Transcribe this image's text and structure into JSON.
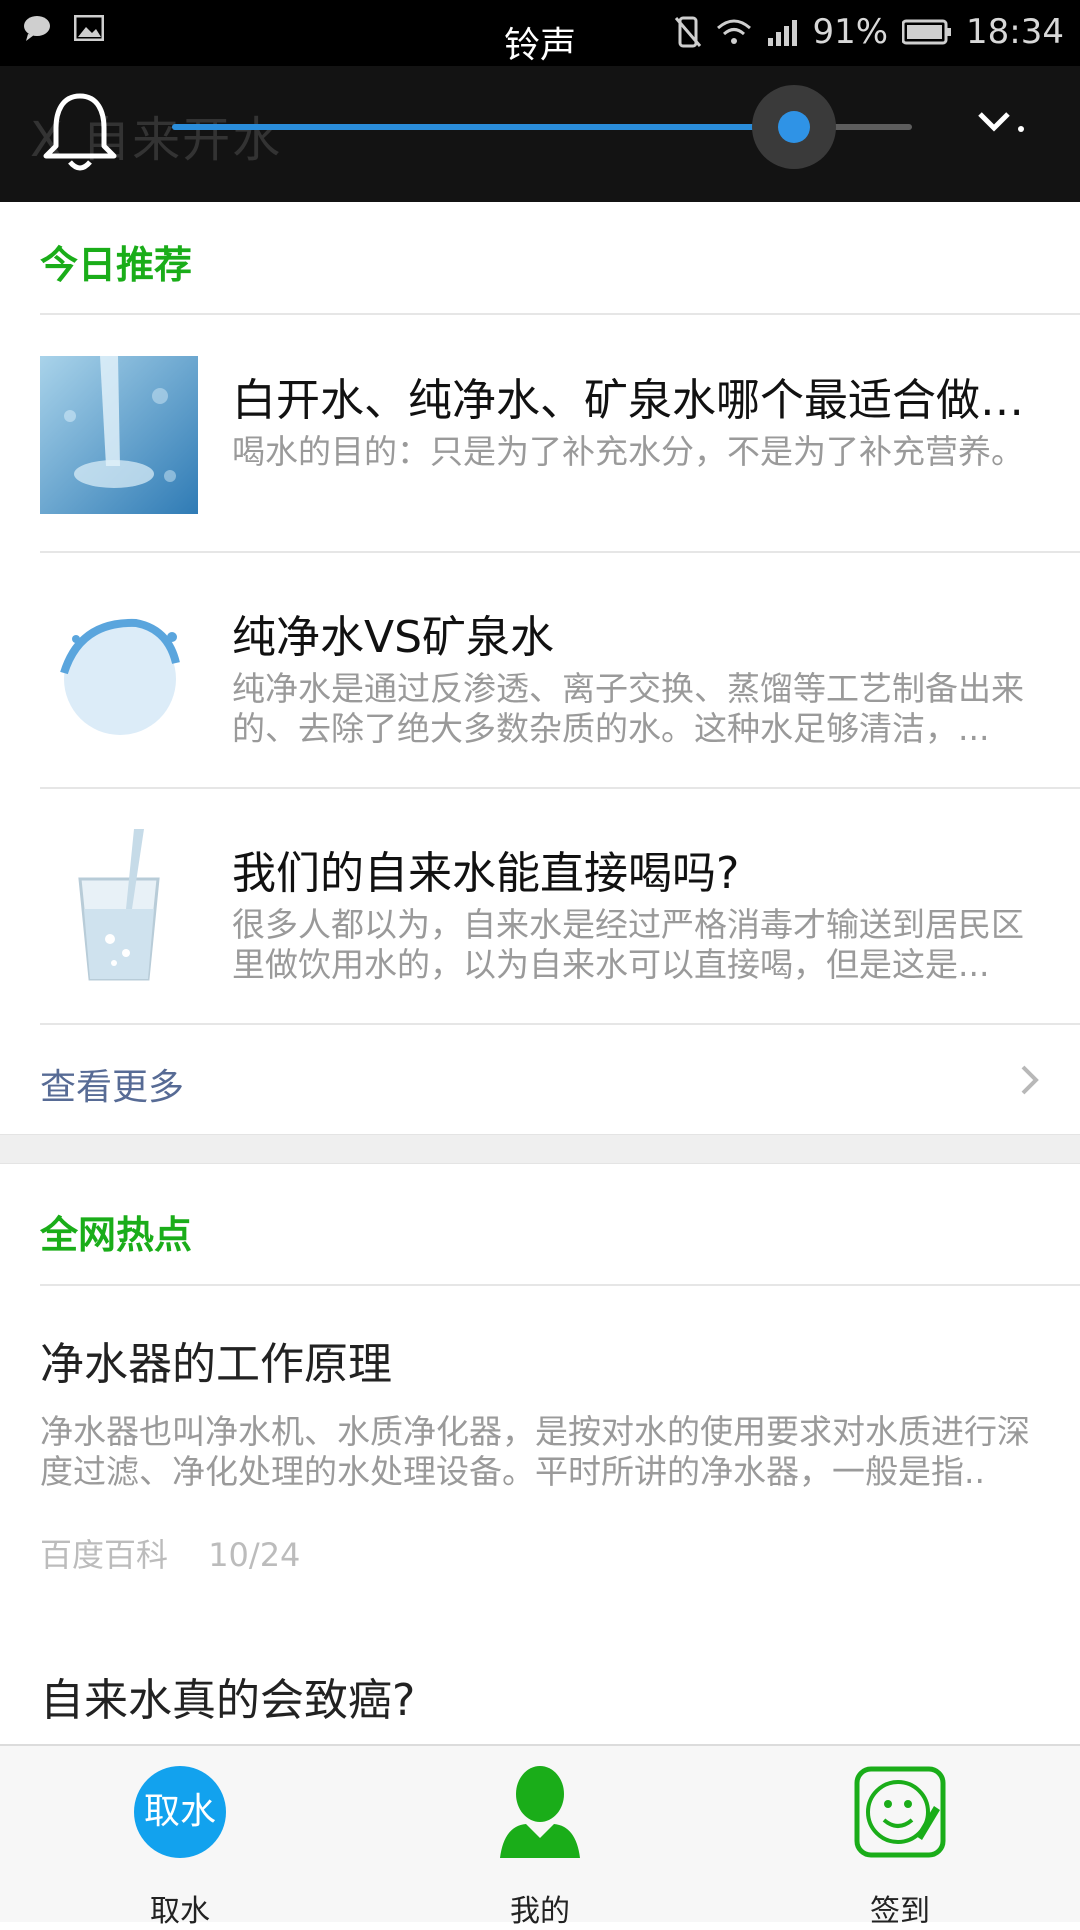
{
  "status_bar": {
    "title": "铃声",
    "battery": "91%",
    "time": "18:34"
  },
  "volume": {
    "ghost_title": "X 自来开水",
    "level": 0.84
  },
  "today": {
    "heading": "今日推荐",
    "items": [
      {
        "title": "白开水、纯净水、矿泉水哪个最适合做长...",
        "desc": "喝水的目的：只是为了补充水分，不是为了补充营养。",
        "thumb": "water-pour-image"
      },
      {
        "title": "纯净水VS矿泉水",
        "desc": "纯净水是通过反渗透、离子交换、蒸馏等工艺制备出来的、去除了绝大多数杂质的水。这种水足够清洁，...",
        "thumb": "water-splash-image"
      },
      {
        "title": "我们的自来水能直接喝吗?",
        "desc": "很多人都以为，自来水是经过严格消毒才输送到居民区里做饮用水的，以为自来水可以直接喝，但是这是...",
        "thumb": "water-glass-image"
      }
    ],
    "more_label": "查看更多"
  },
  "hot": {
    "heading": "全网热点",
    "items": [
      {
        "title": "净水器的工作原理",
        "desc": "净水器也叫净水机、水质净化器，是按对水的使用要求对水质进行深度过滤、净化处理的水处理设备。平时所讲的净水器，一般是指..",
        "source": "百度百科",
        "date": "10/24"
      },
      {
        "title": "自来水真的会致癌?"
      }
    ]
  },
  "tabs": [
    {
      "icon_text": "取水",
      "label": "取水"
    },
    {
      "label": "我的"
    },
    {
      "label": "签到"
    }
  ],
  "colors": {
    "accent_green": "#1aad19",
    "link_blue": "#576b95",
    "take_blue": "#12a2ee"
  }
}
